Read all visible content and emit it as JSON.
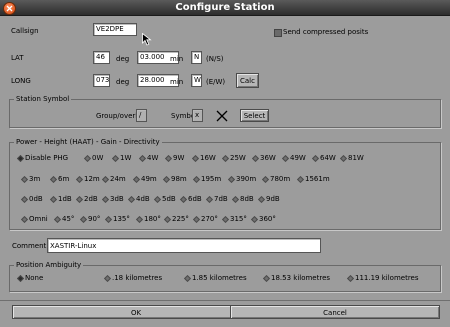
{
  "window": {
    "title": "Configure Station"
  },
  "callsign": {
    "label": "Callsign",
    "value": "VE2DPE"
  },
  "compressed": {
    "label": "Send compressed posits"
  },
  "lat": {
    "label": "LAT",
    "deg_value": "46",
    "deg_unit": "deg",
    "min_value": "03.000",
    "min_unit": "min",
    "hemi_value": "N",
    "hemi_hint": "(N/S)"
  },
  "long": {
    "label": "LONG",
    "deg_value": "073",
    "deg_unit": "deg",
    "min_value": "28.000",
    "min_unit": "min",
    "hemi_value": "W",
    "hemi_hint": "(E/W)",
    "calc_label": "Calc"
  },
  "symbol": {
    "section": "Station Symbol",
    "group_label": "Group/overlay",
    "group_value": "/",
    "symbol_label": "Symbol",
    "symbol_value": "x",
    "select_label": "Select"
  },
  "phg": {
    "section": "Power - Height (HAAT) - Gain - Directivity",
    "rows": [
      [
        "Disable PHG",
        "0W",
        "1W",
        "4W",
        "9W",
        "16W",
        "25W",
        "36W",
        "49W",
        "64W",
        "81W"
      ],
      [
        "3m",
        "6m",
        "12m",
        "24m",
        "49m",
        "98m",
        "195m",
        "390m",
        "780m",
        "1561m"
      ],
      [
        "0dB",
        "1dB",
        "2dB",
        "3dB",
        "4dB",
        "5dB",
        "6dB",
        "7dB",
        "8dB",
        "9dB"
      ],
      [
        "Omni",
        "45°",
        "90°",
        "135°",
        "180°",
        "225°",
        "270°",
        "315°",
        "360°"
      ]
    ]
  },
  "comment": {
    "label": "Comment:",
    "value": "XASTIR-Linux"
  },
  "ambiguity": {
    "section": "Position Ambiguity",
    "options": [
      "None",
      ".18 kilometres",
      "1.85 kilometres",
      "18.53 kilometres",
      "111.19 kilometres"
    ]
  },
  "actions": {
    "ok": "OK",
    "cancel": "Cancel"
  }
}
